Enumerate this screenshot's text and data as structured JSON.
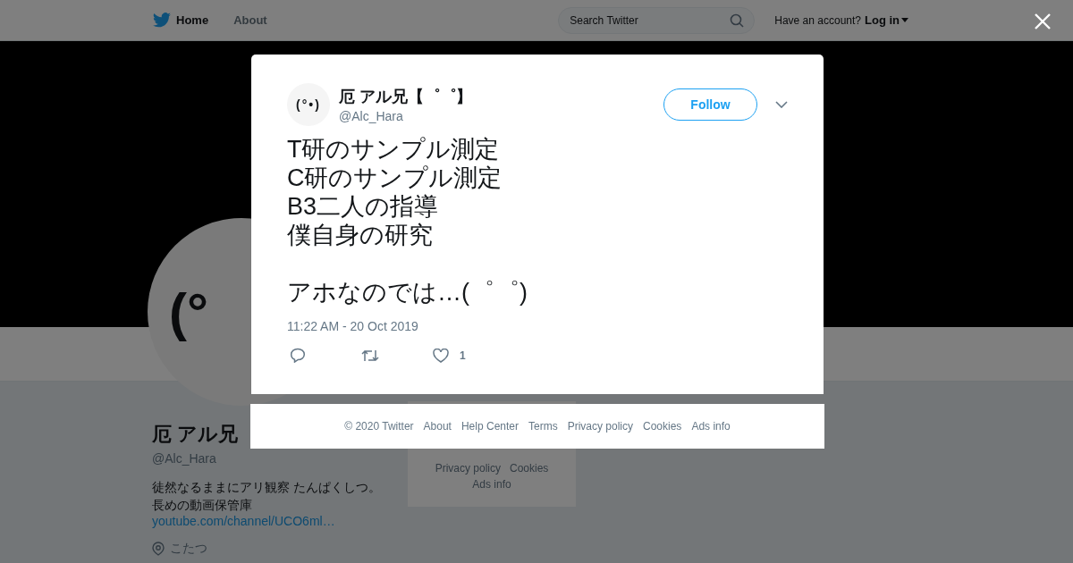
{
  "nav": {
    "items": [
      {
        "label": "Home",
        "selected": true
      },
      {
        "label": "About",
        "selected": false
      }
    ],
    "search": {
      "placeholder": "Search Twitter"
    },
    "account_prompt": "Have an account?",
    "login": "Log in"
  },
  "profile": {
    "avatar_text": "(°",
    "name": "厄 アル兄",
    "handle": "@Alc_Hara",
    "bio": [
      "徒然なるままにアリ観察 たんぱくしつ。",
      "長めの動画保管庫"
    ],
    "link": "youtube.com/channel/UCO6ml…",
    "location": "こたつ"
  },
  "side_footer": {
    "links": [
      "Privacy policy",
      "Cookies",
      "Ads info"
    ]
  },
  "tweet": {
    "avatar_text": "(°•)",
    "name": "厄 アル兄【゜゜】",
    "handle": "@Alc_Hara",
    "follow": "Follow",
    "paragraphs": [
      [
        "T研のサンプル測定",
        "C研のサンプル測定",
        "B3二人の指導",
        "僕自身の研究"
      ],
      [
        "アホなのでは…(゜゜)"
      ]
    ],
    "timestamp": "11:22 AM - 20 Oct 2019",
    "like_count": "1"
  },
  "footer": {
    "links": [
      "© 2020 Twitter",
      "About",
      "Help Center",
      "Terms",
      "Privacy policy",
      "Cookies",
      "Ads info"
    ]
  }
}
